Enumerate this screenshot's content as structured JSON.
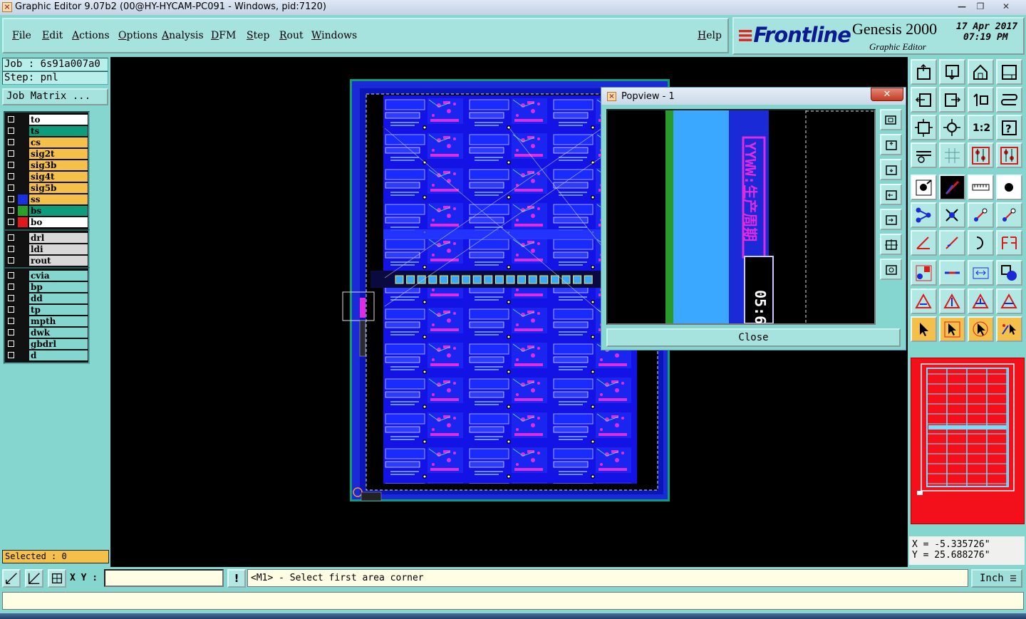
{
  "window": {
    "title": "Graphic Editor 9.07b2 (00@HY-HYCAM-PC091 - Windows, pid:7120)",
    "min_glyph": "—",
    "max_glyph": "❐",
    "close_glyph": "✕"
  },
  "menu": {
    "items": [
      "File",
      "Edit",
      "Actions",
      "Options",
      "Analysis",
      "DFM",
      "Step",
      "Rout",
      "Windows"
    ],
    "help": "Help"
  },
  "brand": {
    "logo": "Frontline",
    "product": "Genesis 2000",
    "subtitle": "Graphic Editor",
    "date": "17 Apr 2017",
    "time": "07:19 PM"
  },
  "left_panel": {
    "job": "Job : 6s91a007a0",
    "step": "Step: pnl",
    "job_matrix_button": "Job Matrix ...",
    "selected": "Selected : 0",
    "layer_groups": [
      [
        {
          "name": "to",
          "color": "#ffffff",
          "swatch": "#111111"
        },
        {
          "name": "ts",
          "color": "#0f9c7d",
          "swatch": "#111111"
        },
        {
          "name": "cs",
          "color": "#f5c04a",
          "swatch": "#111111"
        },
        {
          "name": "sig2t",
          "color": "#f5c04a",
          "swatch": "#111111"
        },
        {
          "name": "sig3b",
          "color": "#f5c04a",
          "swatch": "#111111"
        },
        {
          "name": "sig4t",
          "color": "#f5c04a",
          "swatch": "#111111"
        },
        {
          "name": "sig5b",
          "color": "#f5c04a",
          "swatch": "#111111"
        },
        {
          "name": "ss",
          "color": "#f5c04a",
          "swatch": "#1a2fe0"
        },
        {
          "name": "bs",
          "color": "#0f9c7d",
          "swatch": "#2aa02a"
        },
        {
          "name": "bo",
          "color": "#ffffff",
          "swatch": "#e01818"
        }
      ],
      [
        {
          "name": "drl",
          "color": "#d8d8d8",
          "swatch": "#111111"
        },
        {
          "name": "ldi",
          "color": "#d8d8d8",
          "swatch": "#111111"
        },
        {
          "name": "rout",
          "color": "#d8d8d8",
          "swatch": "#111111"
        }
      ],
      [
        {
          "name": "cvia",
          "color": "#86d6d0",
          "swatch": "#111111"
        },
        {
          "name": "bp",
          "color": "#86d6d0",
          "swatch": "#111111"
        },
        {
          "name": "dd",
          "color": "#86d6d0",
          "swatch": "#111111"
        },
        {
          "name": "tp",
          "color": "#86d6d0",
          "swatch": "#111111"
        },
        {
          "name": "mpth",
          "color": "#86d6d0",
          "swatch": "#111111"
        },
        {
          "name": "dwk",
          "color": "#86d6d0",
          "swatch": "#111111"
        },
        {
          "name": "gbdrl",
          "color": "#86d6d0",
          "swatch": "#111111"
        },
        {
          "name": "d",
          "color": "#86d6d0",
          "swatch": "#111111"
        }
      ]
    ]
  },
  "popview": {
    "title": "Popview - 1",
    "close_glyph": "✕",
    "close_button": "Close",
    "canvas_text": "YYWW:生产周期",
    "canvas_text2": "05:6"
  },
  "right_panel": {
    "tool_icons": [
      "zoom-home-icon",
      "zoom-page-icon",
      "home-icon",
      "window-split-icon",
      "pan-left-icon",
      "pan-right-icon",
      "fit-1-0-icon",
      "s-curve-icon",
      "zoom-fit-icon",
      "zoom-center-icon",
      "scale-1-2-icon",
      "help-query-icon",
      "measure-ruler-icon",
      "grid-icon",
      "layer-red-icon",
      "layer-red-alt-icon",
      "snap-point-icon",
      "draw-red-icon",
      "scale-ruler-icon",
      "circle-pad-icon",
      "node-tree-icon",
      "cross-delete-icon",
      "line-point-icon",
      "line-point-alt-icon",
      "angle-icon",
      "slash-line-icon",
      "arc-icon",
      "mirror-f-icon",
      "select-square-icon",
      "minus-line-icon",
      "dimension-icon",
      "copy-shape-icon",
      "triangle-icon",
      "triangle-up-icon",
      "triangle-arrow-icon",
      "triangle-arrow-alt-icon",
      "pointer-icon",
      "pointer-select-icon",
      "pointer-circle-icon",
      "pointer-multi-icon"
    ],
    "labels": {
      "scale_1_2": "1:2",
      "help_query": "?"
    },
    "coord_x": "X = -5.335726\"",
    "coord_y": "Y = 25.688276\""
  },
  "command_bar": {
    "xy_label": "X Y :",
    "xy_value": "",
    "warn_glyph": "!",
    "prompt": "<M1> - Select first area corner",
    "unit": "Inch",
    "unit_glyph": "☰"
  },
  "colors": {
    "panel_bg": "#86d6d0",
    "board_bg": "#1313e6",
    "board_border": "#0f9c7d",
    "pad_magenta": "#e22be0",
    "minimap_red": "#f4101a"
  }
}
